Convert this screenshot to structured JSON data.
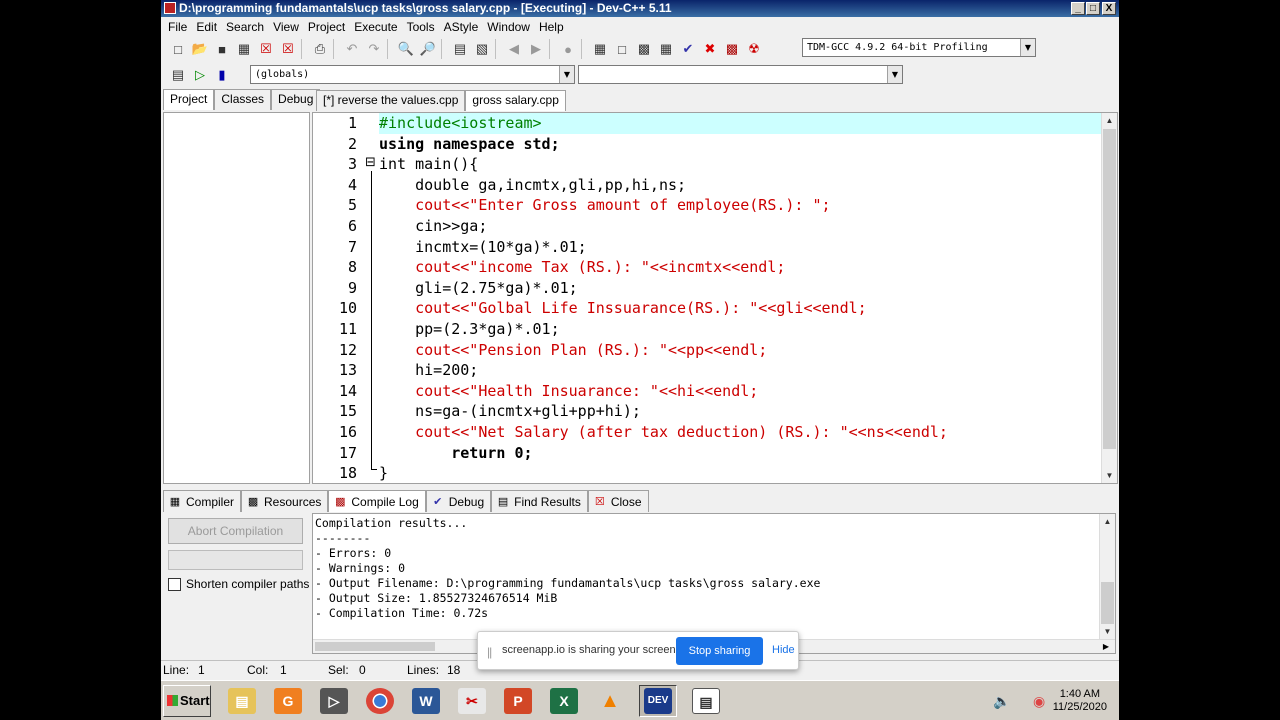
{
  "window": {
    "title": "D:\\programming fundamantals\\ucp tasks\\gross salary.cpp - [Executing] - Dev-C++ 5.11",
    "minimize": "_",
    "maximize": "□",
    "close": "X"
  },
  "menu": [
    "File",
    "Edit",
    "Search",
    "View",
    "Project",
    "Execute",
    "Tools",
    "AStyle",
    "Window",
    "Help"
  ],
  "toolbar": {
    "compiler_select": "TDM-GCC 4.9.2 64-bit Profiling",
    "scope_select": "(globals)",
    "member_select": ""
  },
  "left_tabs": [
    "Project",
    "Classes",
    "Debug"
  ],
  "editor_tabs": [
    "[*] reverse the values.cpp",
    "gross salary.cpp"
  ],
  "editor": {
    "line_numbers": [
      "1",
      "2",
      "3",
      "4",
      "5",
      "6",
      "7",
      "8",
      "9",
      "10",
      "11",
      "12",
      "13",
      "14",
      "15",
      "16",
      "17",
      "18"
    ],
    "lines": [
      "#include<iostream>",
      "using namespace std;",
      "int main(){",
      "    double ga,incmtx,gli,pp,hi,ns;",
      "    cout<<\"Enter Gross amount of employee(RS.): \";",
      "    cin>>ga;",
      "    incmtx=(10*ga)*.01;",
      "    cout<<\"income Tax (RS.): \"<<incmtx<<endl;",
      "    gli=(2.75*ga)*.01;",
      "    cout<<\"Golbal Life Inssuarance(RS.): \"<<gli<<endl;",
      "    pp=(2.3*ga)*.01;",
      "    cout<<\"Pension Plan (RS.): \"<<pp<<endl;",
      "    hi=200;",
      "    cout<<\"Health Insuarance: \"<<hi<<endl;",
      "    ns=ga-(incmtx+gli+pp+hi);",
      "    cout<<\"Net Salary (after tax deduction) (RS.): \"<<ns<<endl;",
      "        return 0;",
      "}"
    ],
    "fold_marker": "⊟"
  },
  "bottom_tabs": [
    "Compiler",
    "Resources",
    "Compile Log",
    "Debug",
    "Find Results",
    "Close"
  ],
  "compile_panel": {
    "abort_button": "Abort Compilation",
    "shorten_paths_label": "Shorten compiler paths",
    "log": [
      "Compilation results...",
      "--------",
      "- Errors: 0",
      "- Warnings: 0",
      "- Output Filename: D:\\programming fundamantals\\ucp tasks\\gross salary.exe",
      "- Output Size: 1.85527324676514 MiB",
      "- Compilation Time: 0.72s"
    ]
  },
  "statusbar": {
    "line_label": "Line:",
    "line_value": "1",
    "col_label": "Col:",
    "col_value": "1",
    "sel_label": "Sel:",
    "sel_value": "0",
    "lines_label": "Lines:",
    "lines_value": "18"
  },
  "screen_share": {
    "message": "screenapp.io is sharing your screen.",
    "stop_button": "Stop sharing",
    "hide_link": "Hide"
  },
  "taskbar": {
    "start": "Start",
    "time": "1:40 AM",
    "date": "11/25/2020"
  },
  "colors": {
    "titlebar": "#0a246a",
    "current_line": "#ccffff",
    "string": "#cc0000",
    "number": "#800080",
    "preprocessor": "#008000",
    "stop_sharing": "#1a73e8"
  }
}
